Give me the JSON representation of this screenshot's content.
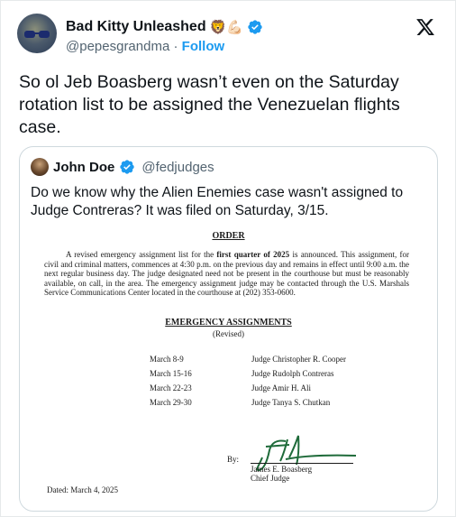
{
  "author": {
    "name": "Bad Kitty Unleashed",
    "name_emojis": "🦁💪🏻",
    "handle": "@pepesgrandma",
    "separator": "·",
    "follow_label": "Follow"
  },
  "tweet": {
    "text": "So ol Jeb Boasberg wasn’t even on the Saturday rotation list to be assigned the Venezuelan flights case."
  },
  "quote": {
    "name": "John Doe",
    "handle": "@fedjudges",
    "text": "Do we know why the Alien Enemies case wasn't assigned to Judge Contreras? It was filed on Saturday, 3/15."
  },
  "document": {
    "order_title": "ORDER",
    "paragraph_pre": "A revised emergency assignment list for the ",
    "paragraph_bold": "first quarter of 2025",
    "paragraph_post": " is announced.  This assignment, for civil and criminal matters, commences at 4:30 p.m. on the previous day and remains in effect until 9:00 a.m. the next regular business day.  The judge designated need not be present in the courthouse but must be reasonably available, on call, in the area.  The emergency assignment judge may be contacted through the U.S. Marshals Service Communications Center located in the courthouse at (202) 353-0600.",
    "assignments_title": "EMERGENCY ASSIGNMENTS",
    "revised": "(Revised)",
    "assignments": [
      {
        "date": "March 8-9",
        "judge": "Judge Christopher R. Cooper"
      },
      {
        "date": "March 15-16",
        "judge": "Judge Rudolph Contreras"
      },
      {
        "date": "March 22-23",
        "judge": "Judge Amir H. Ali"
      },
      {
        "date": "March 29-30",
        "judge": "Judge Tanya S. Chutkan"
      }
    ],
    "by_label": "By:",
    "signer_name": "James E. Boasberg",
    "signer_title": "Chief Judge",
    "dated": "Dated: March 4, 2025"
  },
  "colors": {
    "accent": "#1d9bf0",
    "text": "#0f1419",
    "secondary": "#536471",
    "border": "#cfd9de",
    "signature": "#1f6b3a"
  },
  "icons": {
    "verified": "verified-badge-icon",
    "x_logo": "x-logo-icon"
  }
}
